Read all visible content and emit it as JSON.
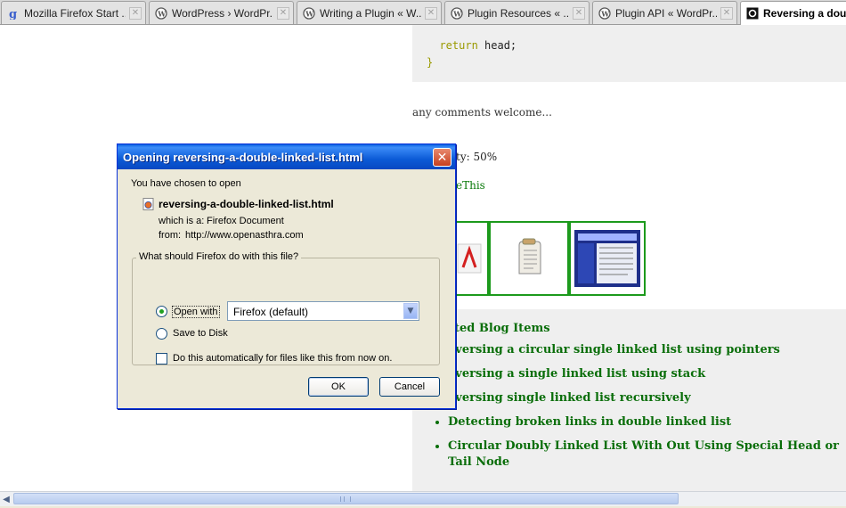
{
  "tabs": [
    {
      "label": "Mozilla Firefox Start ...",
      "icon": "google-g-icon"
    },
    {
      "label": "WordPress › WordPr...",
      "icon": "wordpress-icon"
    },
    {
      "label": "Writing a Plugin « W...",
      "icon": "wordpress-icon"
    },
    {
      "label": "Plugin Resources « ...",
      "icon": "wordpress-icon"
    },
    {
      "label": "Plugin API « WordPr...",
      "icon": "wordpress-icon"
    },
    {
      "label": "Reversing a dou",
      "icon": "site-icon",
      "active": true
    }
  ],
  "page": {
    "code": {
      "keyword": "return",
      "rest": " head;",
      "brace": "}"
    },
    "comment": "any comments welcome...",
    "popularity": "ty: 50%",
    "sharethis": "eThis",
    "related": {
      "heading": "ted Blog Items",
      "items": [
        "eversing a circular single linked list using pointers",
        "eversing a single linked list using stack",
        "eversing single linked list recursively",
        "Detecting broken links in double linked list",
        "Circular Doubly Linked List With Out Using Special Head or Tail Node"
      ]
    }
  },
  "dialog": {
    "title": "Opening reversing-a-double-linked-list.html",
    "chosen": "You have chosen to open",
    "filename": "reversing-a-double-linked-list.html",
    "which_is_label": "which is a:",
    "which_is_value": "Firefox Document",
    "from_label": "from:",
    "from_value": "http://www.openasthra.com",
    "group_label": "What should Firefox do with this file?",
    "open_with_label": "Open with",
    "open_with_value": "Firefox (default)",
    "save_label": "Save to Disk",
    "auto_label": "Do this automatically for files like this from now on.",
    "ok": "OK",
    "cancel": "Cancel"
  },
  "colors": {
    "link_green": "#0a6e0a",
    "title_blue": "#0a5fe0",
    "dialog_bg": "#ece9d8"
  }
}
